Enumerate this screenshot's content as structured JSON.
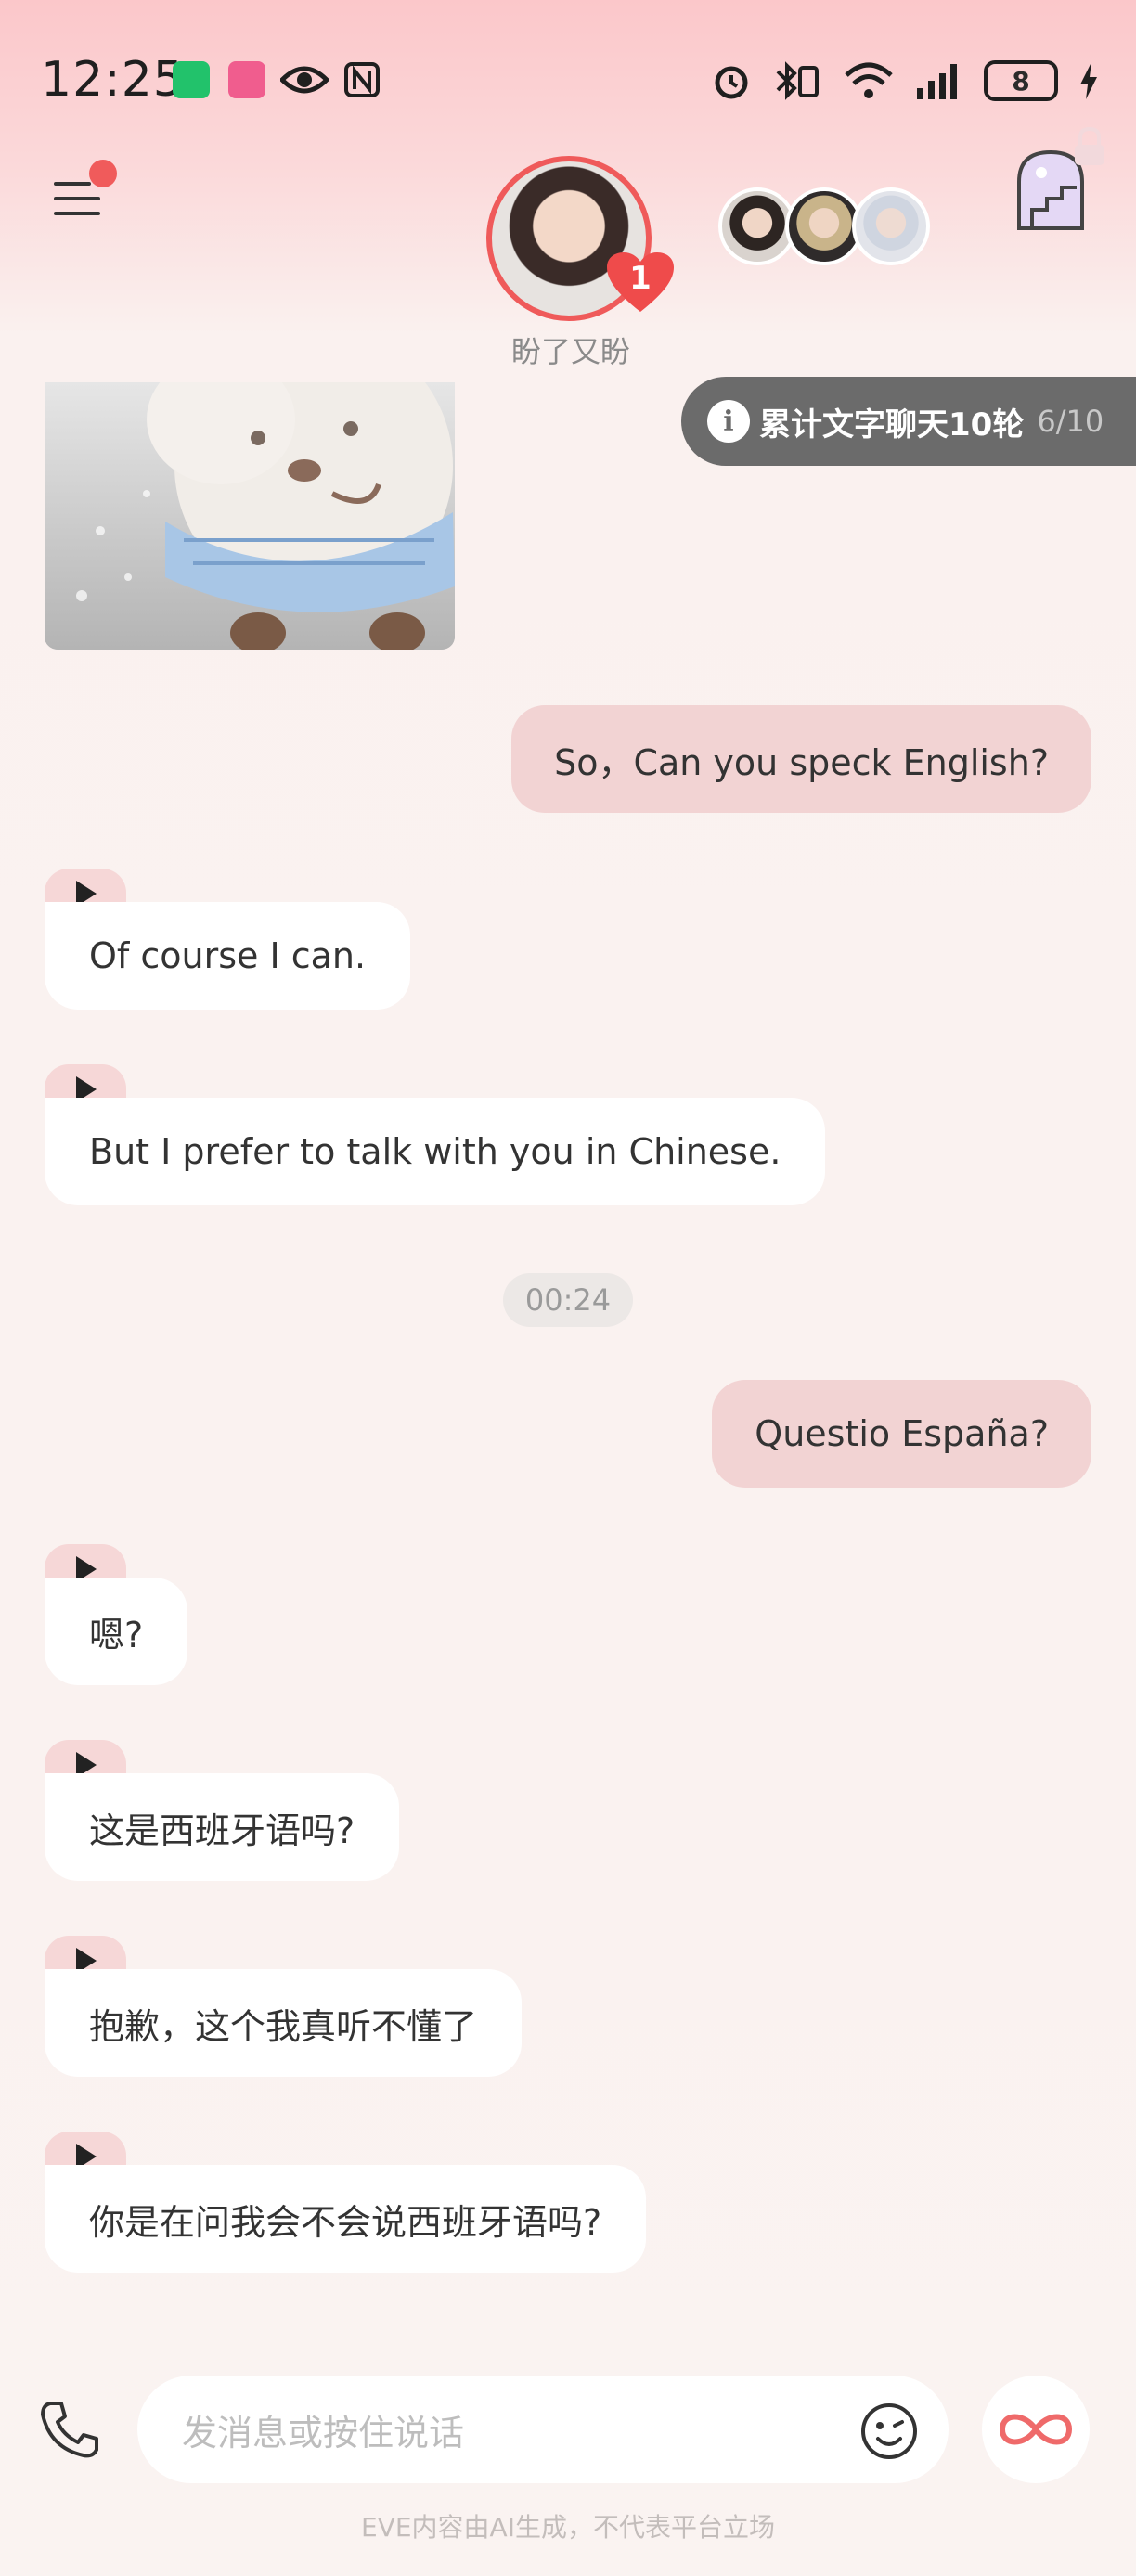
{
  "status_bar": {
    "time": "12:25",
    "battery": "8",
    "icons": [
      "hourglass-app-icon",
      "bilibili-app-icon",
      "eye-icon",
      "nfc-icon",
      "alarm-icon",
      "bluetooth-icon",
      "wifi-icon",
      "signal-icon",
      "battery-icon",
      "charging-icon"
    ]
  },
  "header": {
    "character_name": "盼了又盼",
    "badge_count": "1",
    "icons": [
      "menu-icon",
      "door-icon",
      "lock-icon"
    ]
  },
  "task": {
    "text": "累计文字聊天10轮",
    "progress": "6/10",
    "progress_fraction": 0.6
  },
  "messages": [
    {
      "role": "user",
      "text": "So，Can you speck English?"
    },
    {
      "role": "ai",
      "text": "Of course I can."
    },
    {
      "role": "ai",
      "text": "But I prefer to talk with you in Chinese."
    },
    {
      "role": "time",
      "text": "00:24"
    },
    {
      "role": "user",
      "text": "Questio España?"
    },
    {
      "role": "ai",
      "text": "嗯?"
    },
    {
      "role": "ai",
      "text": "这是西班牙语吗?"
    },
    {
      "role": "ai",
      "text": "抱歉，这个我真听不懂了"
    },
    {
      "role": "ai",
      "text": "你是在问我会不会说西班牙语吗?"
    }
  ],
  "input": {
    "placeholder": "发消息或按住说话"
  },
  "footer": {
    "disclaimer": "EVE内容由AI生成，不代表平台立场"
  },
  "colors": {
    "accent": "#ef5a5a",
    "user_bubble": "#f2d3d3",
    "ai_bubble": "#ffffff",
    "task_pill": "#6b6b6b"
  }
}
